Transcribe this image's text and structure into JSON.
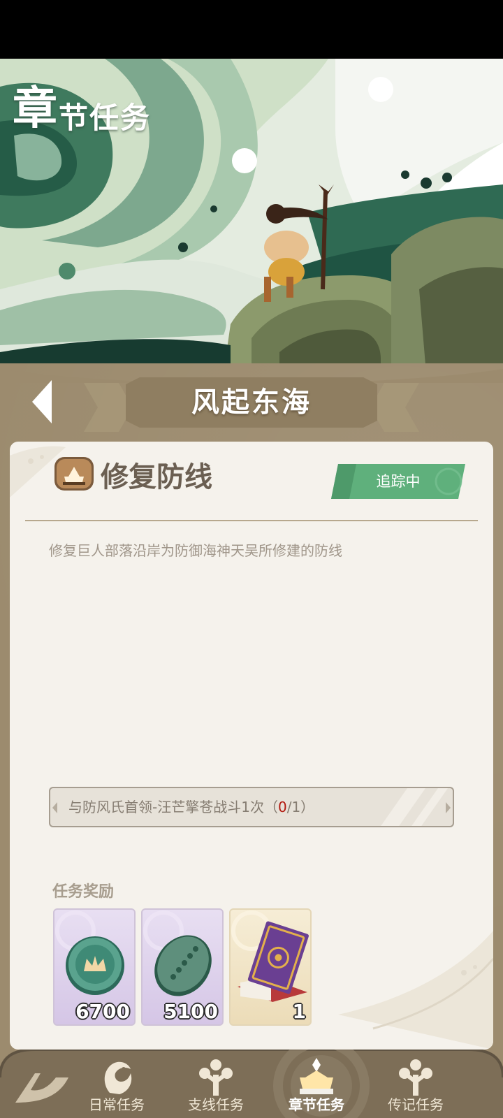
{
  "page": {
    "title_first_char": "章",
    "title_rest": "节任务"
  },
  "chapter": {
    "title": "风起东海"
  },
  "quest": {
    "name": "修复防线",
    "tracking_label": "追踪中",
    "description": "修复巨人部落沿岸为防御海神天吴所修建的防线",
    "objective": {
      "text": "与防风氏首领-汪芒擎苍战斗1次",
      "progress_open": "（",
      "current": "0",
      "separator": "/",
      "total": "1",
      "progress_close": "）"
    }
  },
  "rewards": {
    "label": "任务奖励",
    "items": [
      {
        "icon": "jade-coin-icon",
        "count": "6700",
        "rarity": "purple"
      },
      {
        "icon": "jade-stone-icon",
        "count": "5100",
        "rarity": "purple"
      },
      {
        "icon": "ticket-book-icon",
        "count": "1",
        "rarity": "gold"
      }
    ]
  },
  "nav": {
    "items": [
      {
        "label": "日常任务",
        "icon": "bird-icon",
        "active": false
      },
      {
        "label": "支线任务",
        "icon": "tree-icon",
        "active": false
      },
      {
        "label": "章节任务",
        "icon": "chest-icon",
        "active": true
      },
      {
        "label": "传记任务",
        "icon": "tree-icon",
        "active": false
      }
    ]
  },
  "colors": {
    "accent_green": "#5fb07c",
    "panel_brown": "#9c8b6e",
    "card_bg": "#f5f2ec",
    "progress_red": "#b31a10"
  }
}
